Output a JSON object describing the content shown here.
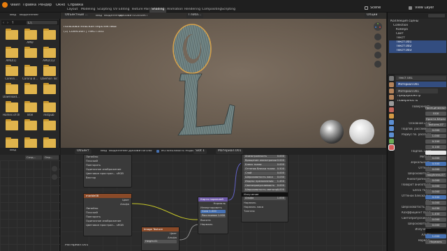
{
  "topbar": {
    "menus": [
      "Файл",
      "Правка",
      "Рендер",
      "Окно",
      "Справка"
    ],
    "workspaces": [
      "Layout",
      "Modeling",
      "Sculpting",
      "UV Editing",
      "Texture Paint",
      "Shading",
      "Animation",
      "Rendering",
      "Compositing",
      "Scripting"
    ],
    "active_workspace": "Shading",
    "scene_label": "Scene",
    "view_layer_label": "View Layer"
  },
  "filebrowser": {
    "header_items": [
      "Вид",
      "Выделение"
    ],
    "path": "C:\\",
    "folders": [
      {
        "label": ""
      },
      {
        "label": "AMD"
      },
      {
        "label": ""
      },
      {
        "label": "AMD(1)"
      },
      {
        "label": ""
      },
      {
        "label": "AMD(1)2"
      },
      {
        "label": "Corelin..."
      },
      {
        "label": "Corona B..."
      },
      {
        "label": "Daemon Tools"
      },
      {
        "label": "Download..."
      },
      {
        "label": ""
      },
      {
        "label": ""
      },
      {
        "label": "Homes of th..."
      },
      {
        "label": "Intel"
      },
      {
        "label": "mstpub"
      },
      {
        "label": ""
      },
      {
        "label": ""
      },
      {
        "label": ""
      },
      {
        "label": "Musik sk"
      },
      {
        "label": "PerfLogs"
      },
      {
        "label": ""
      }
    ]
  },
  "viewport": {
    "mode": "Объектный ...",
    "menu": [
      "Вид",
      "Выделение",
      "Добавить",
      "Объект"
    ],
    "transform": "Глоба...",
    "options": "Опции",
    "overlay_title": "Пользовательская перспектива",
    "overlay_subtitle": "(1) Collection | Текст.001"
  },
  "nodeeditor": {
    "mode": "Объект",
    "menu": [
      "Вид",
      "Выделение",
      "Добавить",
      "Узлы"
    ],
    "use_nodes": "Использовать ноды",
    "slot": "Slot 1",
    "material": "Материал.001",
    "footer": "Материал.001",
    "image_node": {
      "title": "Image Texture",
      "rows": [
        "Линейно",
        "Плоский",
        "Повторять",
        "Одиночное изображение",
        "Цветовое простран...",
        "Вектор"
      ],
      "colorspace_value": "sRGB",
      "fields": [
        "Цвет",
        "Альфа"
      ]
    },
    "image_node2": {
      "title": "marble08",
      "rows": [
        "Линейно",
        "Плоский",
        "Повторять",
        "Одиночное изображение",
        "Цветовое простран...",
        "Вектор"
      ],
      "colorspace_value": "sRGB",
      "fields": [
        "Цвет",
        "Альфа"
      ]
    },
    "image_node3": {
      "title": "Image Texture",
      "file": "Height.01",
      "fields": [
        "Цвет",
        "Альфа"
      ]
    },
    "bump_node": {
      "title": "Карта нормалей",
      "rows": [
        "Нормаль",
        "Инвертировать",
        "Сила",
        "Расстояние",
        "Высота",
        "Нормаль"
      ],
      "strength": "1.000",
      "distance": "1.000"
    },
    "bsdf_node": {
      "rows": [
        {
          "label": "Анизотропность",
          "value": "0.000"
        },
        {
          "label": "Вращение анизотропии",
          "value": "0.000"
        },
        {
          "label": "Блеск ткани",
          "value": "0.000"
        },
        {
          "label": "Оттенок блеска ткани",
          "value": "0.500"
        },
        {
          "label": "Слой",
          "value": "0.000"
        },
        {
          "label": "Шероховатость лака",
          "value": "0.030"
        },
        {
          "label": "Индекс преломления",
          "value": "1.450"
        },
        {
          "label": "Светопропускаемость",
          "value": "0.000"
        },
        {
          "label": "Шероховатость светопр...",
          "value": "0.000"
        },
        {
          "label": "Излучение",
          "value": ""
        },
        {
          "label": "Альфа",
          "value": "1.000"
        },
        {
          "label": "Нормаль",
          "value": ""
        },
        {
          "label": "Нормаль лака",
          "value": ""
        },
        {
          "label": "Тангенс",
          "value": ""
        }
      ]
    }
  },
  "leftlower": {
    "menu": [
      "Вид"
    ],
    "field1": "Созд...",
    "field2": "Опр..."
  },
  "outliner": {
    "title": "Сцена",
    "items": [
      {
        "label": "Коллекция сцены",
        "selected": false
      },
      {
        "label": "Collection",
        "selected": false
      },
      {
        "label": "Камера",
        "selected": false
      },
      {
        "label": "Свет",
        "selected": false
      },
      {
        "label": "Текст",
        "selected": false
      },
      {
        "label": "Текст.001",
        "selected": true
      },
      {
        "label": "Текст.002",
        "selected": true
      },
      {
        "label": "Текст.003",
        "selected": true
      }
    ]
  },
  "properties": {
    "object_name": "Текст.001",
    "material_slot": "Материал.001",
    "material_name": "Материал.001",
    "sections": [
      "Предпросмотр",
      "Поверхность"
    ],
    "rows": [
      {
        "label": "Поверхность",
        "value": "Принципиальный",
        "style": "plain"
      },
      {
        "label": "",
        "value": "GGX",
        "style": "plain"
      },
      {
        "label": "",
        "value": "Кристи.Бёрли",
        "style": "plain"
      },
      {
        "label": "Основной цвет",
        "value": "Textures.07",
        "style": "plain"
      },
      {
        "label": "Подпов. рассеивание",
        "value": "0.000",
        "style": "plain"
      },
      {
        "label": "Радиус по. рассеивания",
        "value": "1.000",
        "style": "plain"
      },
      {
        "label": "",
        "value": "0.200",
        "style": "plain"
      },
      {
        "label": "",
        "value": "0.100",
        "style": "plain"
      },
      {
        "label": "Подпов. цвет",
        "value": "",
        "style": "white"
      },
      {
        "label": "Металл",
        "value": "0.000",
        "style": "plain"
      },
      {
        "label": "Зеркальность",
        "value": "0.500",
        "style": "blue"
      },
      {
        "label": "Оттенок",
        "value": "0.000",
        "style": "plain"
      },
      {
        "label": "Шероховатость",
        "value": "roughness.07",
        "style": "plain"
      },
      {
        "label": "Анизотропность",
        "value": "0.000",
        "style": "plain"
      },
      {
        "label": "Поворот анизотропии",
        "value": "0.000",
        "style": "plain"
      },
      {
        "label": "Блеск ткани",
        "value": "0.000",
        "style": "plain"
      },
      {
        "label": "Оттенок блеска ткани",
        "value": "0.500",
        "style": "blue"
      },
      {
        "label": "Лак",
        "value": "0.000",
        "style": "plain"
      },
      {
        "label": "Шероховатость лака",
        "value": "0.030",
        "style": "plain"
      },
      {
        "label": "Коэффициент прелом.",
        "value": "1.450",
        "style": "plain"
      },
      {
        "label": "Светопропускаемость",
        "value": "0.000",
        "style": "plain"
      },
      {
        "label": "Шероховатость",
        "value": "0.000",
        "style": "plain"
      },
      {
        "label": "Излучение",
        "value": "",
        "style": "dark"
      },
      {
        "label": "Альфа",
        "value": "1.000",
        "style": "blue"
      },
      {
        "label": "Нормаль",
        "value": "Нормаль",
        "style": "plain"
      }
    ]
  }
}
